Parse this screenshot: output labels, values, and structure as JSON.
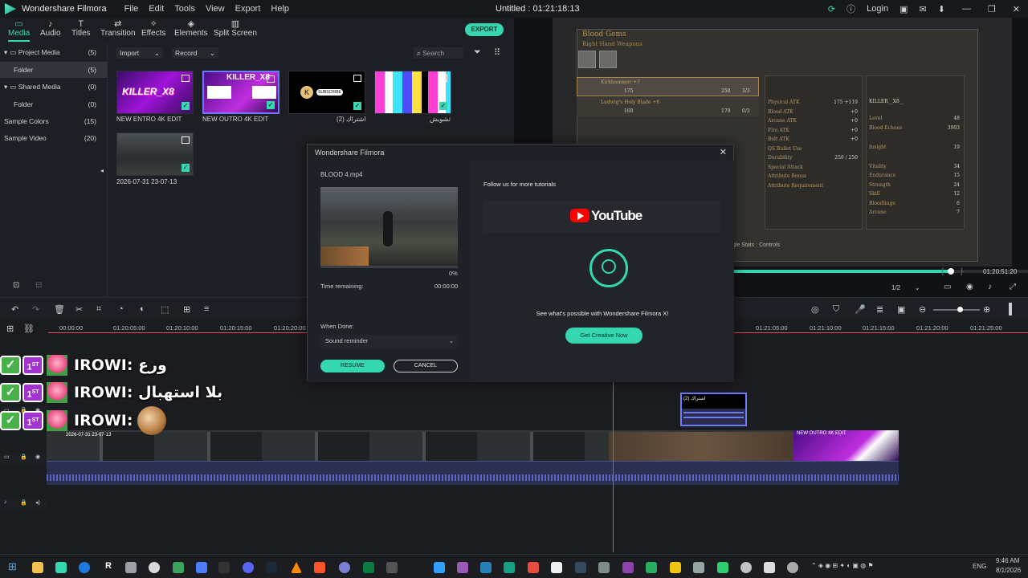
{
  "app": {
    "name": "Wondershare Filmora",
    "document_title": "Untitled : 01:21:18:13",
    "login": "Login"
  },
  "menu": [
    "File",
    "Edit",
    "Tools",
    "View",
    "Export",
    "Help"
  ],
  "tabs": [
    {
      "label": "Media",
      "icon": "folder-icon"
    },
    {
      "label": "Audio",
      "icon": "music-note-icon"
    },
    {
      "label": "Titles",
      "icon": "text-icon"
    },
    {
      "label": "Transition",
      "icon": "transition-icon"
    },
    {
      "label": "Effects",
      "icon": "effects-icon"
    },
    {
      "label": "Elements",
      "icon": "elements-icon"
    },
    {
      "label": "Split Screen",
      "icon": "split-screen-icon"
    }
  ],
  "export_label": "EXPORT",
  "sidebar": {
    "items": [
      {
        "label": "Project Media",
        "count": "(5)"
      },
      {
        "label": "Folder",
        "count": "(5)"
      },
      {
        "label": "Shared Media",
        "count": "(0)"
      },
      {
        "label": "Folder",
        "count": "(0)"
      },
      {
        "label": "Sample Colors",
        "count": "(15)"
      },
      {
        "label": "Sample Video",
        "count": "(20)"
      }
    ]
  },
  "media_toolbar": {
    "import": "Import",
    "record": "Record",
    "search_placeholder": "Search"
  },
  "media_items": [
    {
      "label": "NEW ENTRO 4K EDIT",
      "thumb_text": "KILLER_X8"
    },
    {
      "label": "NEW OUTRO 4K EDIT",
      "thumb_text": "KILLER_X8"
    },
    {
      "label": "اشتراك (2)",
      "thumb_text": "SUBSCRIBE"
    },
    {
      "label": "تشويش",
      "thumb_text": ""
    },
    {
      "label": "2026-07-31 23-07-13",
      "thumb_text": ""
    }
  ],
  "preview": {
    "game_panel": {
      "title": "Blood Gems",
      "subtitle": "Right Hand Weapons",
      "weapons": [
        {
          "name": "Kirkhammer +7",
          "v1": "175",
          "v2": "250",
          "v3": "3/3"
        },
        {
          "name": "Ludwig's Holy Blade +6",
          "v1": "160",
          "v2": "179",
          "v3": "0/3"
        }
      ],
      "stats_mid": [
        "Physical ATK",
        "Blood ATK",
        "Arcane ATK",
        "Fire ATK",
        "Bolt ATK",
        "QS Bullet Use",
        "Durability",
        "Special Attack",
        "Attribute Bonus",
        "Attribute Requirement"
      ],
      "mid_values": [
        "175 +119",
        "+0",
        "+0",
        "+0",
        "+0",
        "",
        "250 / 250",
        "",
        "",
        ""
      ],
      "player": "KILLER__X8__",
      "stats_right": [
        {
          "k": "Level",
          "v": "48"
        },
        {
          "k": "Blood Echoes",
          "v": "3903"
        },
        {
          "k": "Insight",
          "v": "19"
        },
        {
          "k": "Vitality",
          "v": "34"
        },
        {
          "k": "Endurance",
          "v": "15"
        },
        {
          "k": "Strength",
          "v": "24"
        },
        {
          "k": "Skill",
          "v": "12"
        },
        {
          "k": "Bloodtinge",
          "v": "6"
        },
        {
          "k": "Arcane",
          "v": "7"
        }
      ],
      "footer": "gle Stats    : Controls"
    },
    "timecode": "01:20:51:20",
    "quality": "1/2",
    "progress": 0.85
  },
  "dialog": {
    "title": "Wondershare Filmora",
    "filename": "BLOOD 4.mp4",
    "percent": "0%",
    "time_remaining_label": "Time remaining:",
    "time_remaining": "00:00:00",
    "when_done_label": "When Done:",
    "when_done_value": "Sound reminder",
    "resume": "RESUME",
    "cancel": "CANCEL",
    "follow": "Follow us for more tutorials",
    "youtube": "YouTube",
    "see": "See what's possible with Wondershare Filmora X!",
    "cta": "Get Creative Now"
  },
  "ruler": [
    "00:00:00",
    "01:20:05:00",
    "01:20:10:00",
    "01:20:15:00",
    "01:20:20:00",
    "01:21:05:00",
    "01:21:10:00",
    "01:21:15:00",
    "01:21:20:00",
    "01:21:25:00"
  ],
  "tracks": {
    "stickers": [
      {
        "name": "IROWI:",
        "text": "ورع"
      },
      {
        "name": "IROWI:",
        "text": "بلا استهبال"
      },
      {
        "name": "IROWI:",
        "text": ""
      }
    ],
    "clip_label": "2026-07-31 23-07-13",
    "subscribe_clip_label": "(اشتراك (2",
    "outro_label": "NEW OUTRO 4K EDIT"
  },
  "taskbar": {
    "time": "9:46 AM",
    "date": "8/1/2026",
    "lang": "ENG"
  },
  "colors": {
    "accent": "#34d7b0",
    "playhead": "#e8485b",
    "selection": "#6d79ff"
  }
}
